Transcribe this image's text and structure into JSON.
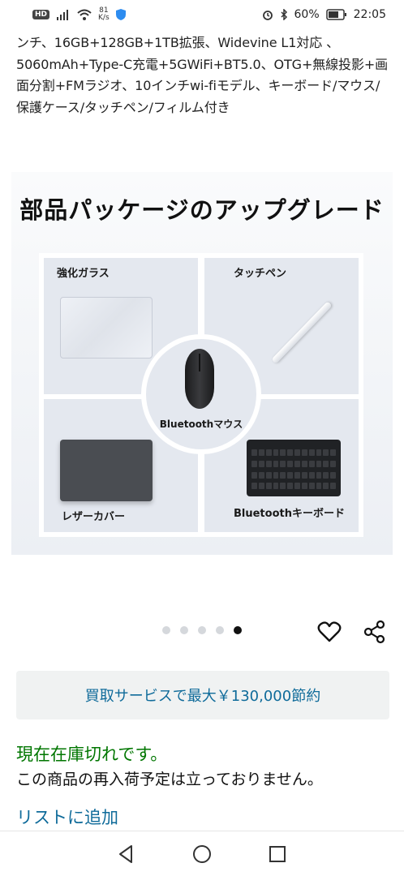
{
  "status_bar": {
    "hd": "HD",
    "net_speed_value": "81",
    "net_speed_unit": "K/s",
    "battery": "60%",
    "time": "22:05",
    "icons": [
      "signal-icon",
      "wifi-icon",
      "shield-icon",
      "alarm-icon",
      "bluetooth-icon",
      "battery-icon"
    ]
  },
  "product": {
    "title": "ンチ、16GB+128GB+1TB拡張、Widevine L1対応 、5060mAh+Type-C充電+5GWiFi+BT5.0、OTG+無線投影+画面分割+FMラジオ、10インチwi-fiモデル、キーボード/マウス/保護ケース/タッチペン/フィルム付き"
  },
  "image": {
    "heading": "部品パッケージのアップグレード",
    "items": {
      "top_left": "強化ガラス",
      "top_right": "タッチペン",
      "center": "Bluetoothマウス",
      "bottom_left": "レザーカバー",
      "bottom_right": "Bluetoothキーボード"
    }
  },
  "carousel": {
    "total": 5,
    "active_index": 4
  },
  "actions": {
    "icons": [
      "heart-icon",
      "share-icon"
    ]
  },
  "tradein": {
    "label": "買取サービスで最大￥130,000節約"
  },
  "availability": {
    "status": "現在在庫切れです。",
    "note": "この商品の再入荷予定は立っておりません。"
  },
  "add_to_list": "リストに追加",
  "colors": {
    "link": "#0f6b9a",
    "in_stock_status": "#007600"
  },
  "nav": {
    "icons": [
      "back-icon",
      "home-icon",
      "recents-icon"
    ]
  }
}
